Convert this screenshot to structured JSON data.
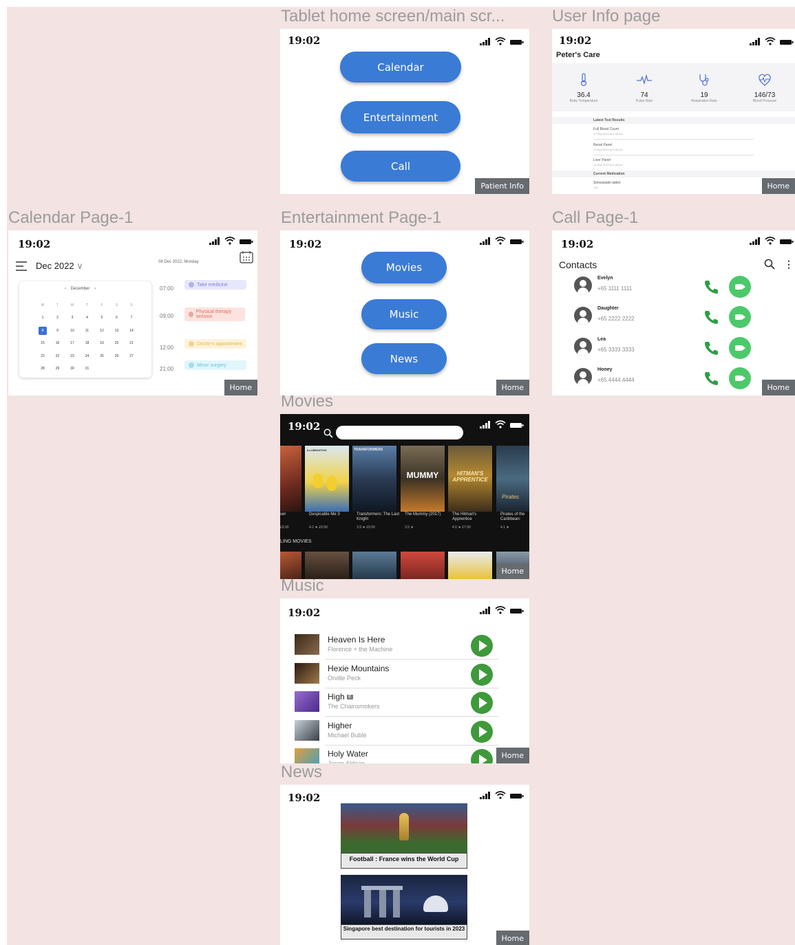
{
  "frames": {
    "tablet_home": "Tablet home screen/main scr...",
    "user_info": "User Info page",
    "calendar": "Calendar Page-1",
    "entertainment": "Entertainment Page-1",
    "call": "Call Page-1",
    "movies": "Movies",
    "music": "Music",
    "news": "News"
  },
  "status_time": "19:02",
  "home_label": "Home",
  "tablet_home": {
    "buttons": [
      "Calendar",
      "Entertainment",
      "Call"
    ],
    "patient_info": "Patient Info"
  },
  "user_info": {
    "title": "Peter's Care",
    "vitals": [
      {
        "icon": "thermometer-icon",
        "value": "36.4",
        "label": "Body Temperature"
      },
      {
        "icon": "pulse-icon",
        "value": "74",
        "label": "Pulse Rate"
      },
      {
        "icon": "stethoscope-icon",
        "value": "19",
        "label": "Respiration Rate"
      },
      {
        "icon": "heart-monitor-icon",
        "value": "146/73",
        "label": "Blood Pressure"
      }
    ],
    "latest_tests": "Latest Test Results",
    "tests": [
      {
        "name": "Full Blood Count",
        "date": "12 Sep 2019 at 9:48 am"
      },
      {
        "name": "Renal Panel",
        "date": "12 Sep 2019 at 9:50 pm"
      },
      {
        "name": "Liver Panel",
        "date": "12 Sep 2019 at 9:48 pm"
      }
    ],
    "current_medication": "Current Medication",
    "medication": {
      "name": "Simvastatin tablet",
      "dose": "1x1"
    }
  },
  "calendar": {
    "month_label": "Dec 2022",
    "date_heading": "08 Dec 2022, Monday",
    "mini_month": "December",
    "weekdays": [
      "M",
      "T",
      "W",
      "T",
      "F",
      "S",
      "S"
    ],
    "weeks": [
      [
        "1",
        "2",
        "3",
        "4",
        "5",
        "6",
        "7"
      ],
      [
        "8",
        "9",
        "10",
        "11",
        "12",
        "13",
        "14"
      ],
      [
        "15",
        "16",
        "17",
        "18",
        "19",
        "20",
        "21"
      ],
      [
        "22",
        "22",
        "23",
        "24",
        "25",
        "26",
        "27"
      ],
      [
        "28",
        "29",
        "30",
        "31",
        "",
        "",
        ""
      ]
    ],
    "events": [
      {
        "time": "07:00",
        "title": "Take medicine",
        "color": "#7b7fd6",
        "bg": "#e6e7fb"
      },
      {
        "time": "09:00",
        "title": "Physical therapy session",
        "color": "#e06a5a",
        "bg": "#fde3df"
      },
      {
        "time": "12:00",
        "title": "Doctor's appointment",
        "color": "#e6b73b",
        "bg": "#fdf3dc"
      },
      {
        "time": "21:00",
        "title": "Minor surgery",
        "color": "#5cc6e0",
        "bg": "#e2f6fb"
      }
    ]
  },
  "entertainment": {
    "buttons": [
      "Movies",
      "Music",
      "News"
    ]
  },
  "call": {
    "title": "Contacts",
    "contacts": [
      {
        "name": "Evelyn",
        "number": "+65 1111 1111"
      },
      {
        "name": "Daughter",
        "number": "+65 2222 2222"
      },
      {
        "name": "Lea",
        "number": "+65 3333 3333"
      },
      {
        "name": "Honey",
        "number": "+65 4444 4444"
      }
    ]
  },
  "movies": {
    "items": [
      {
        "title": "ver",
        "rating": "£9.90"
      },
      {
        "title": "Despicable Me 3",
        "rating": "4.2 ★  £9.99"
      },
      {
        "title": "Transformers: The Last Knight",
        "rating": "3.9 ★  £9.99"
      },
      {
        "title": "The Mummy (2017)",
        "rating": "3.5 ★"
      },
      {
        "title": "The Hitman's Apprentice",
        "rating": "4.0 ★  £7.99"
      },
      {
        "title": "Pirates of the Caribbean:",
        "rating": "4.1 ★"
      }
    ],
    "section": "LING MOVIES",
    "posters": {
      "minions": "ILLUMINATION",
      "transformers": "TRANSFORMERS",
      "mummy": "MUMMY",
      "hitman": "HITMAN'S APPRENTICE",
      "pirates": "Pirates"
    }
  },
  "music": {
    "songs": [
      {
        "title": "Heaven Is Here",
        "artist": "Florence + the Machine",
        "explicit": false
      },
      {
        "title": "Hexie Mountains",
        "artist": "Orville Peck",
        "explicit": false
      },
      {
        "title": "High",
        "artist": "The Chainsmokers",
        "explicit": true
      },
      {
        "title": "Higher",
        "artist": "Michael Bublé",
        "explicit": false
      },
      {
        "title": "Holy Water",
        "artist": "Jason Aldean",
        "explicit": false
      }
    ],
    "explicit_badge": "E"
  },
  "news": {
    "items": [
      {
        "caption": "Football : France wins the World Cup"
      },
      {
        "caption": "Singapore best destination for tourists in 2023"
      }
    ]
  }
}
